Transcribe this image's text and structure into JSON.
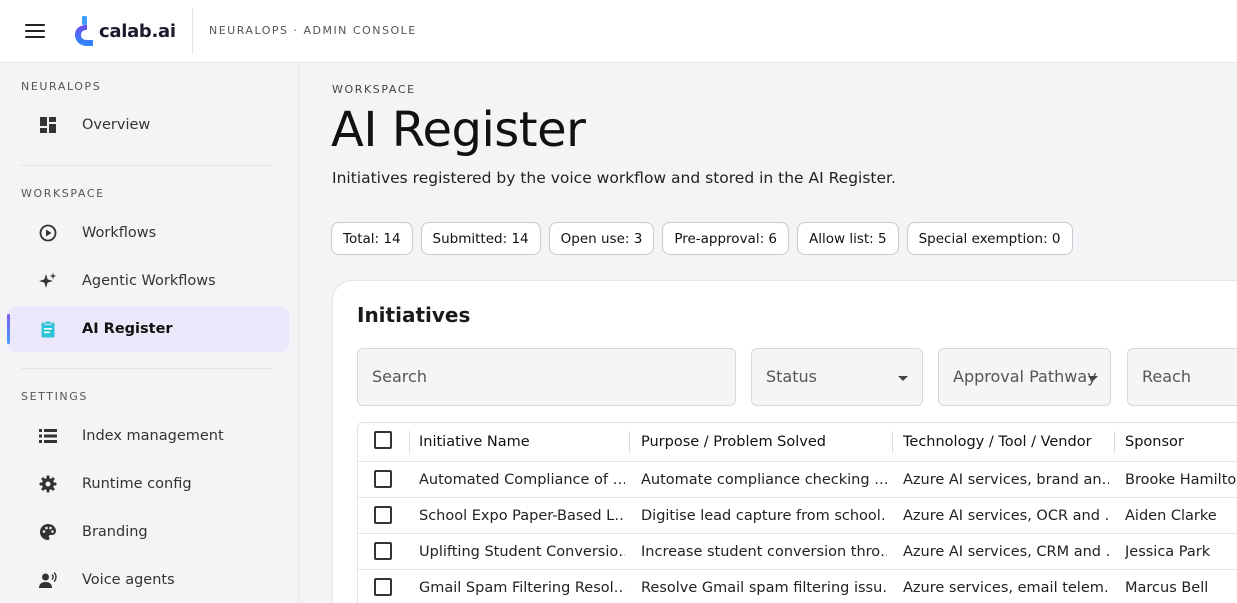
{
  "app": {
    "brand": "calab.ai",
    "context": "NEURALOPS · ADMIN CONSOLE"
  },
  "sidebar": {
    "sections": [
      {
        "title": "NEURALOPS",
        "items": [
          {
            "label": "Overview",
            "icon": "dashboard-icon"
          }
        ]
      },
      {
        "title": "WORKSPACE",
        "items": [
          {
            "label": "Workflows",
            "icon": "play-circle-icon"
          },
          {
            "label": "Agentic Workflows",
            "icon": "sparkles-icon"
          },
          {
            "label": "AI Register",
            "icon": "clipboard-icon",
            "active": true
          }
        ]
      },
      {
        "title": "SETTINGS",
        "items": [
          {
            "label": "Index management",
            "icon": "list-icon"
          },
          {
            "label": "Runtime config",
            "icon": "gear-icon"
          },
          {
            "label": "Branding",
            "icon": "palette-icon"
          },
          {
            "label": "Voice agents",
            "icon": "voice-agent-icon"
          }
        ]
      }
    ]
  },
  "main": {
    "eyebrow": "WORKSPACE",
    "title": "AI Register",
    "subtitle": "Initiatives registered by the voice workflow and stored in the AI Register.",
    "chips": [
      "Total: 14",
      "Submitted: 14",
      "Open use: 3",
      "Pre-approval: 6",
      "Allow list: 5",
      "Special exemption: 0"
    ],
    "card": {
      "title": "Initiatives",
      "filters": {
        "search_placeholder": "Search",
        "status_label": "Status",
        "approval_label": "Approval Pathway",
        "reach_label": "Reach"
      },
      "table": {
        "columns": [
          "Initiative Name",
          "Purpose / Problem Solved",
          "Technology / Tool / Vendor",
          "Sponsor"
        ],
        "rows": [
          [
            "Automated Compliance of …",
            "Automate compliance checking …",
            "Azure AI services, brand an…",
            "Brooke Hamilton"
          ],
          [
            "School Expo Paper-Based L…",
            "Digitise lead capture from school…",
            "Azure AI services, OCR and …",
            "Aiden Clarke"
          ],
          [
            "Uplifting Student Conversio…",
            "Increase student conversion thro…",
            "Azure AI services, CRM and …",
            "Jessica Park"
          ],
          [
            "Gmail Spam Filtering Resol…",
            "Resolve Gmail spam filtering issu…",
            "Azure services, email telem…",
            "Marcus Bell"
          ]
        ]
      }
    }
  },
  "colors": {
    "accent": "#7a5cf0",
    "active_bg": "#ece8fb",
    "sidebar_bg": "#f3f4f6"
  }
}
